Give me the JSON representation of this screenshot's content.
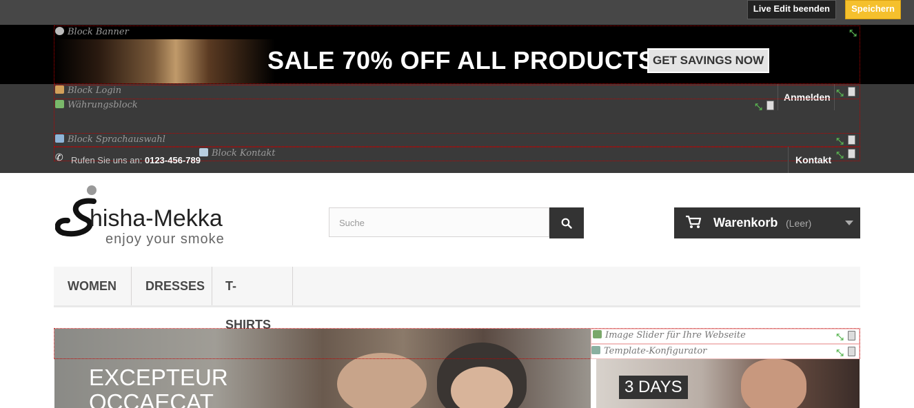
{
  "toolbar": {
    "live_edit_label": "Live Edit beenden",
    "save_label": "Speichern"
  },
  "modules": {
    "banner": "Block Banner",
    "login": "Block Login",
    "currency": "Währungsblock",
    "language": "Block Sprachauswahl",
    "contact": "Block Kontakt",
    "slider": "Image Slider für Ihre Webseite",
    "template": "Template-Konfigurator"
  },
  "banner": {
    "headline": "SALE 70% OFF ALL PRODUCTS",
    "button": "GET SAVINGS NOW"
  },
  "nav": {
    "login_label": "Anmelden",
    "contact_label": "Kontakt"
  },
  "contact_info": {
    "prefix": "Rufen Sie uns an:",
    "phone": "0123-456-789"
  },
  "logo": {
    "name": "hisha-Mekka",
    "tagline": "enjoy your smoke"
  },
  "search": {
    "placeholder": "Suche"
  },
  "cart": {
    "label": "Warenkorb",
    "status": "(Leer)"
  },
  "menu": [
    "WOMEN",
    "DRESSES",
    "T-SHIRTS"
  ],
  "slide": {
    "line1": "EXCEPTEUR",
    "line2": "OCCAECAT"
  },
  "side_banner": {
    "days": "3 DAYS"
  },
  "colors": {
    "accent_save": "#f5c02d",
    "dark_band": "#3a3a3a",
    "outline": "#c20000",
    "expand": "#5ab552"
  },
  "icons": [
    "gear-icon",
    "user-icon",
    "money-icon",
    "language-icon",
    "id-card-icon",
    "phone-icon",
    "expand-icon",
    "trash-icon",
    "search-icon",
    "cart-icon",
    "chevron-down-icon",
    "image-icon"
  ]
}
